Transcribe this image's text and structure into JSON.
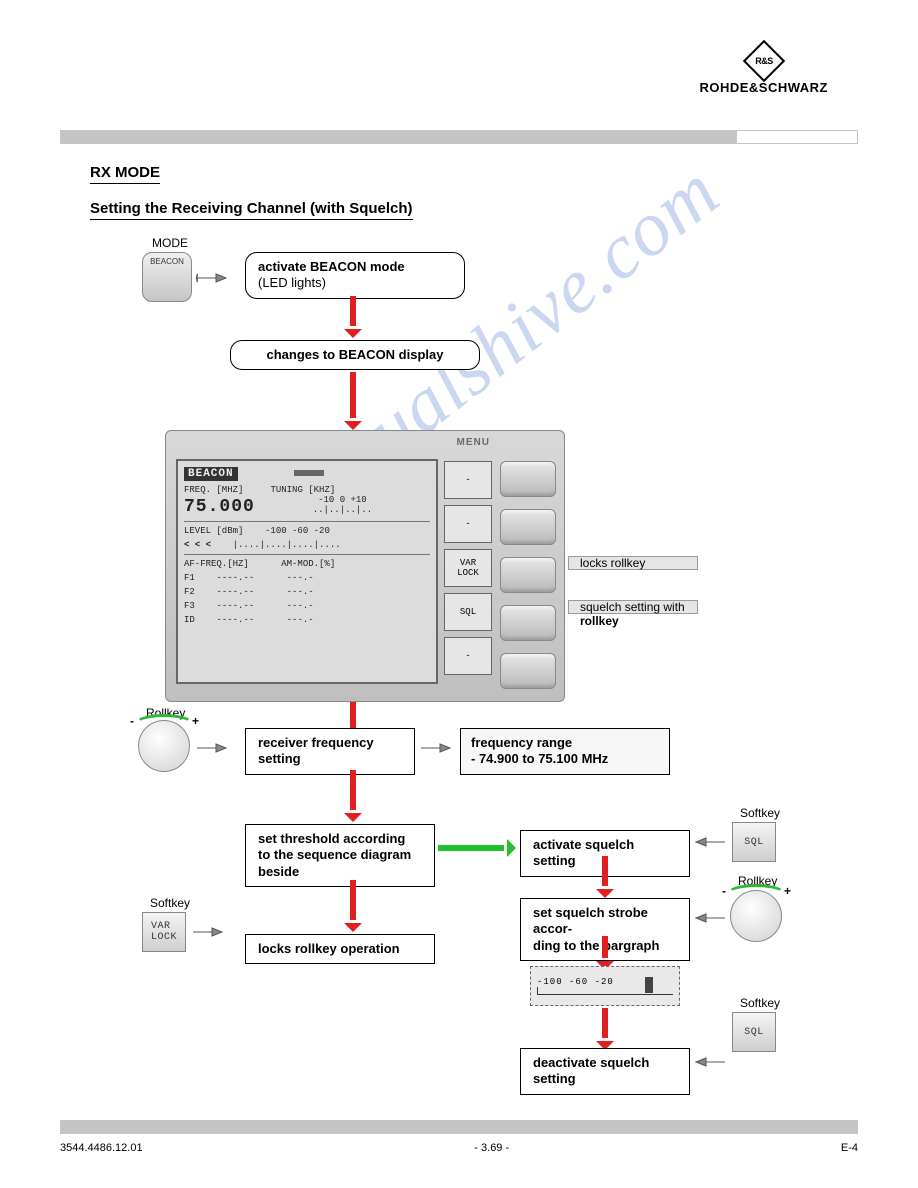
{
  "brand": "ROHDE&SCHWARZ",
  "watermark": "manualshive.com",
  "section": {
    "title1": "RX MODE",
    "title2": "Setting the Receiving Channel (with Squelch)"
  },
  "mode_key_group": "MODE",
  "mode_key_name": "BEACON",
  "softkey_group": "Softkey",
  "rollkey_group": "Rollkey",
  "step1": {
    "bold": "activate BEACON mode",
    "sub": "(LED lights)"
  },
  "step2": "changes to  BEACON display",
  "lcd": {
    "menu": "MENU",
    "title": "BEACON",
    "freq_label": "FREQ. [MHZ]",
    "tuning_label": "TUNING [KHZ]",
    "tuning_ticks": "-10     0    +10",
    "freq_value": "75.000",
    "level_label": "LEVEL [dBm]",
    "level_ticks": "-100    -60     -20",
    "level_arrows": "< < <",
    "af_label": "AF-FREQ.[HZ]",
    "am_label": "AM-MOD.[%]",
    "rows": [
      "F1",
      "F2",
      "F3",
      "ID"
    ],
    "dashes": "----.--",
    "dashes2": "---.-",
    "soft": [
      "-",
      "-",
      "VAR\nLOCK",
      "SQL",
      "-"
    ]
  },
  "annot1": "locks rollkey",
  "annot2a": "squelch setting with",
  "annot2b": "rollkey",
  "step3": {
    "bold1": "receiver frequency",
    "bold2": "setting"
  },
  "freq_range": {
    "label": "frequency range",
    "value": "-   74.900 to 75.100 MHz"
  },
  "step4a": "set threshold according",
  "step4b": "to the sequence diagram",
  "step4c": "beside",
  "step5": "locks rollkey operation",
  "sq1": "activate squelch setting",
  "sq2a": "set squelch strobe accor-",
  "sq2b": "ding  to the bargraph",
  "sq3a": "deactivate squelch",
  "sq3b": "setting",
  "softkey_varlock": "VAR\nLOCK",
  "softkey_sql": "SQL",
  "bargraph_ticks": "-100    -60     -20",
  "footer": {
    "left": "3544.4486.12.01",
    "center": "- 3.69 -",
    "right": "E-4"
  }
}
